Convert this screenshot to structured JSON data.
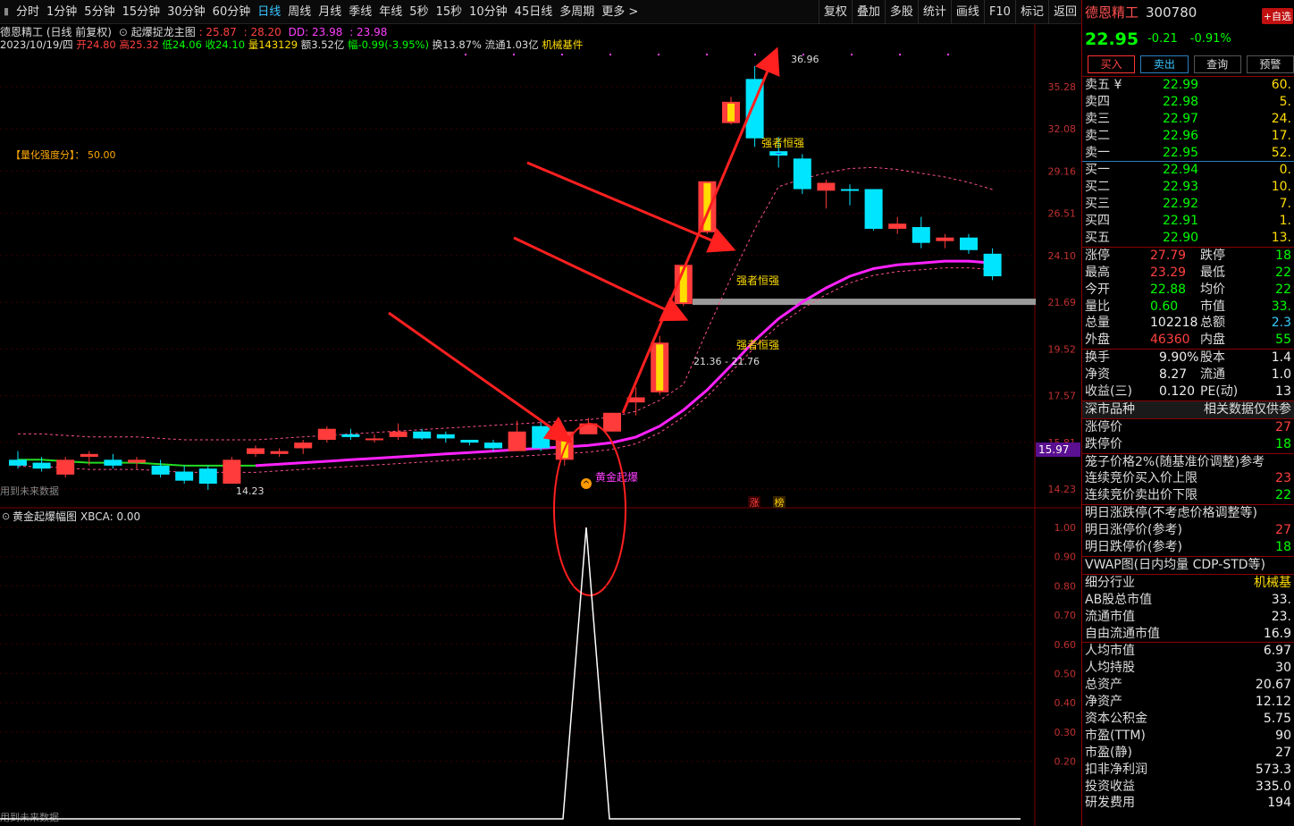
{
  "topbar": {
    "periods": [
      "分时",
      "1分钟",
      "5分钟",
      "15分钟",
      "30分钟",
      "60分钟",
      "日线",
      "周线",
      "月线",
      "季线",
      "年线",
      "5秒",
      "15秒",
      "10分钟",
      "45日线",
      "多周期",
      "更多 >"
    ],
    "active": "日线",
    "right": [
      "复权",
      "叠加",
      "多股",
      "统计",
      "画线",
      "F10",
      "标记",
      "返回"
    ]
  },
  "info": {
    "title": "德恩精工 (日线 前复权)",
    "indicator_name": "起爆捉龙主图",
    "ind_v1": ": 25.87",
    "ind_v2": ": 28.20",
    "ind_dd": "DD: 23.98",
    "ind_v3": ": 23.98",
    "date": "2023/10/19/四",
    "open": "开24.80",
    "high": "高25.32",
    "low": "低24.06",
    "close": "收24.10",
    "vol": "量143129",
    "amt": "额3.52亿",
    "chg": "幅-0.99(-3.95%)",
    "turnover": "换13.87%",
    "float": "流通1.03亿",
    "sector": "机械基件"
  },
  "chart": {
    "y_ticks": [
      "35.28",
      "32.08",
      "29.16",
      "26.51",
      "24.10",
      "21.69",
      "19.52",
      "17.57",
      "15.81",
      "14.23"
    ],
    "current_price_tag": "15.97",
    "label_quant": "【量化强度分】：  50.00",
    "label_strong": "强者恒强",
    "label_gold": "黄金起爆",
    "label_high": "36.96",
    "label_low": "14.23",
    "label_range": "21.36 - 21.76",
    "label_future": "用到未来数据",
    "tag_limit1": "涨",
    "tag_limit2": "榜",
    "sub_title": "黄金起爆幅图",
    "sub_value": "XBCA: 0.00",
    "sub_ticks": [
      "1.00",
      "0.90",
      "0.80",
      "0.70",
      "0.60",
      "0.50",
      "0.40",
      "0.30",
      "0.20"
    ],
    "colors": {
      "up": "#ff3b3b",
      "down": "#00e5ff",
      "ma": "#ff22ff",
      "arrow": "#ff2020",
      "signal": "#ffdd00"
    }
  },
  "chart_data": {
    "type": "candlestick",
    "candles": [
      {
        "o": 15.2,
        "h": 15.5,
        "l": 14.9,
        "c": 15.0
      },
      {
        "o": 15.1,
        "h": 15.3,
        "l": 14.8,
        "c": 14.9
      },
      {
        "o": 14.7,
        "h": 15.3,
        "l": 14.6,
        "c": 15.2
      },
      {
        "o": 15.3,
        "h": 15.5,
        "l": 15.0,
        "c": 15.4
      },
      {
        "o": 15.2,
        "h": 15.4,
        "l": 14.9,
        "c": 15.0
      },
      {
        "o": 15.1,
        "h": 15.3,
        "l": 14.9,
        "c": 15.2
      },
      {
        "o": 15.0,
        "h": 15.2,
        "l": 14.6,
        "c": 14.7
      },
      {
        "o": 14.8,
        "h": 15.0,
        "l": 14.4,
        "c": 14.5
      },
      {
        "o": 14.9,
        "h": 15.0,
        "l": 14.2,
        "c": 14.4
      },
      {
        "o": 14.4,
        "h": 15.3,
        "l": 14.4,
        "c": 15.2
      },
      {
        "o": 15.4,
        "h": 15.7,
        "l": 15.3,
        "c": 15.6
      },
      {
        "o": 15.4,
        "h": 15.6,
        "l": 15.3,
        "c": 15.5
      },
      {
        "o": 15.6,
        "h": 15.9,
        "l": 15.4,
        "c": 15.8
      },
      {
        "o": 15.9,
        "h": 16.4,
        "l": 15.8,
        "c": 16.3
      },
      {
        "o": 16.1,
        "h": 16.3,
        "l": 15.9,
        "c": 16.0
      },
      {
        "o": 15.9,
        "h": 16.1,
        "l": 15.8,
        "c": 15.95
      },
      {
        "o": 16.0,
        "h": 16.5,
        "l": 15.9,
        "c": 16.2
      },
      {
        "o": 16.2,
        "h": 16.3,
        "l": 15.9,
        "c": 15.95
      },
      {
        "o": 16.1,
        "h": 16.2,
        "l": 15.8,
        "c": 15.95
      },
      {
        "o": 15.9,
        "h": 15.9,
        "l": 15.7,
        "c": 15.8
      },
      {
        "o": 15.8,
        "h": 15.9,
        "l": 15.5,
        "c": 15.6
      },
      {
        "o": 15.5,
        "h": 16.6,
        "l": 15.5,
        "c": 16.2
      },
      {
        "o": 16.4,
        "h": 16.6,
        "l": 15.5,
        "c": 15.6
      },
      {
        "o": 15.2,
        "h": 16.2,
        "l": 15.0,
        "c": 16.2,
        "sig": true
      },
      {
        "o": 16.1,
        "h": 16.7,
        "l": 16.1,
        "c": 16.5
      },
      {
        "o": 16.2,
        "h": 16.9,
        "l": 16.2,
        "c": 16.9
      },
      {
        "o": 17.3,
        "h": 17.9,
        "l": 16.8,
        "c": 17.5
      },
      {
        "o": 17.7,
        "h": 20.1,
        "l": 17.6,
        "c": 19.8,
        "sig": true
      },
      {
        "o": 21.6,
        "h": 22.0,
        "l": 21.5,
        "c": 23.6,
        "sig": true
      },
      {
        "o": 25.4,
        "h": 25.4,
        "l": 25.3,
        "c": 28.5,
        "sig": true
      },
      {
        "o": 32.5,
        "h": 34.5,
        "l": 32.4,
        "c": 34.1,
        "sig": true
      },
      {
        "o": 35.9,
        "h": 36.96,
        "l": 30.8,
        "c": 31.4
      },
      {
        "o": 30.5,
        "h": 31.5,
        "l": 29.4,
        "c": 30.2
      },
      {
        "o": 30.0,
        "h": 30.3,
        "l": 27.7,
        "c": 28.0
      },
      {
        "o": 27.9,
        "h": 28.6,
        "l": 26.8,
        "c": 28.4
      },
      {
        "o": 28.0,
        "h": 28.3,
        "l": 27.0,
        "c": 27.9
      },
      {
        "o": 28.0,
        "h": 28.0,
        "l": 25.5,
        "c": 25.6
      },
      {
        "o": 25.6,
        "h": 26.3,
        "l": 25.3,
        "c": 25.9
      },
      {
        "o": 25.7,
        "h": 26.3,
        "l": 24.5,
        "c": 24.8
      },
      {
        "o": 24.9,
        "h": 25.3,
        "l": 24.5,
        "c": 25.1
      },
      {
        "o": 25.1,
        "h": 25.3,
        "l": 24.2,
        "c": 24.4
      },
      {
        "o": 24.2,
        "h": 24.5,
        "l": 22.8,
        "c": 23.0
      }
    ],
    "ma": [
      15.2,
      15.2,
      15.15,
      15.1,
      15.1,
      15.1,
      15.05,
      15.0,
      15.0,
      15.0,
      15.0,
      15.05,
      15.1,
      15.15,
      15.2,
      15.25,
      15.3,
      15.35,
      15.4,
      15.45,
      15.5,
      15.55,
      15.6,
      15.65,
      15.7,
      15.8,
      16.0,
      16.4,
      17.0,
      17.8,
      18.8,
      19.9,
      20.9,
      21.7,
      22.4,
      23.0,
      23.4,
      23.6,
      23.7,
      23.8,
      23.8,
      23.7
    ]
  },
  "panel": {
    "stock_name": "德恩精工",
    "stock_code": "300780",
    "add_btn": "+自选",
    "price": "22.95",
    "change": "-0.21",
    "change_pct": "-0.91%",
    "buttons": [
      "买入",
      "卖出",
      "查询",
      "预警"
    ],
    "asks": [
      {
        "l": "卖五 ¥",
        "p": "22.99",
        "v": "60."
      },
      {
        "l": "卖四",
        "p": "22.98",
        "v": "5."
      },
      {
        "l": "卖三",
        "p": "22.97",
        "v": "24."
      },
      {
        "l": "卖二",
        "p": "22.96",
        "v": "17."
      },
      {
        "l": "卖一",
        "p": "22.95",
        "v": "52."
      }
    ],
    "bids": [
      {
        "l": "买一",
        "p": "22.94",
        "v": "0."
      },
      {
        "l": "买二",
        "p": "22.93",
        "v": "10."
      },
      {
        "l": "买三",
        "p": "22.92",
        "v": "7."
      },
      {
        "l": "买四",
        "p": "22.91",
        "v": "1."
      },
      {
        "l": "买五",
        "p": "22.90",
        "v": "13."
      }
    ],
    "stats1": [
      {
        "l": "涨停",
        "v": "27.79",
        "l2": "跌停",
        "v2": "18"
      },
      {
        "l": "最高",
        "v": "23.29",
        "l2": "最低",
        "v2": "22"
      },
      {
        "l": "今开",
        "v": "22.88",
        "l2": "均价",
        "v2": "22"
      },
      {
        "l": "量比",
        "v": "0.60",
        "l2": "市值",
        "v2": "33."
      },
      {
        "l": "总量",
        "v": "102218",
        "l2": "总额",
        "v2": "2.3"
      },
      {
        "l": "外盘",
        "v": "46360",
        "l2": "内盘",
        "v2": "55"
      }
    ],
    "stats2": [
      {
        "l": "换手",
        "v": "9.90%",
        "l2": "股本",
        "v2": "1.4"
      },
      {
        "l": "净资",
        "v": "8.27",
        "l2": "流通",
        "v2": "1.0"
      },
      {
        "l": "收益(三)",
        "v": "0.120",
        "l2": "PE(动)",
        "v2": "13"
      }
    ],
    "sect_hdr": "深市品种",
    "sect_hdr2": "相关数据仅供参",
    "limit_rows": [
      {
        "l": "涨停价",
        "v": "27"
      },
      {
        "l": "跌停价",
        "v": "18"
      }
    ],
    "cage_title": "笼子价格2%(随基准价调整)参考",
    "cage_rows": [
      {
        "l": "连续竞价买入价上限",
        "v": "23"
      },
      {
        "l": "连续竞价卖出价下限",
        "v": "22"
      }
    ],
    "tmr_title": "明日涨跌停(不考虑价格调整等)",
    "tmr_rows": [
      {
        "l": "明日涨停价(参考)",
        "v": "27"
      },
      {
        "l": "明日跌停价(参考)",
        "v": "18"
      }
    ],
    "vwap": "VWAP图(日内均量 CDP-STD等)",
    "fund_rows": [
      {
        "l": "细分行业",
        "v": "机械基"
      },
      {
        "l": "AB股总市值",
        "v": "33."
      },
      {
        "l": "流通市值",
        "v": "23."
      },
      {
        "l": "自由流通市值",
        "v": "16.9"
      }
    ],
    "fund_rows2": [
      {
        "l": "人均市值",
        "v": "6.97"
      },
      {
        "l": "人均持股",
        "v": "30"
      },
      {
        "l": "总资产",
        "v": "20.67"
      },
      {
        "l": "净资产",
        "v": "12.12"
      },
      {
        "l": "资本公积金",
        "v": "5.75"
      },
      {
        "l": "市盈(TTM)",
        "v": "90"
      },
      {
        "l": "市盈(静)",
        "v": "27"
      },
      {
        "l": "扣非净利润",
        "v": "573.3"
      },
      {
        "l": "投资收益",
        "v": "335.0"
      },
      {
        "l": "研发费用",
        "v": "194"
      }
    ]
  }
}
